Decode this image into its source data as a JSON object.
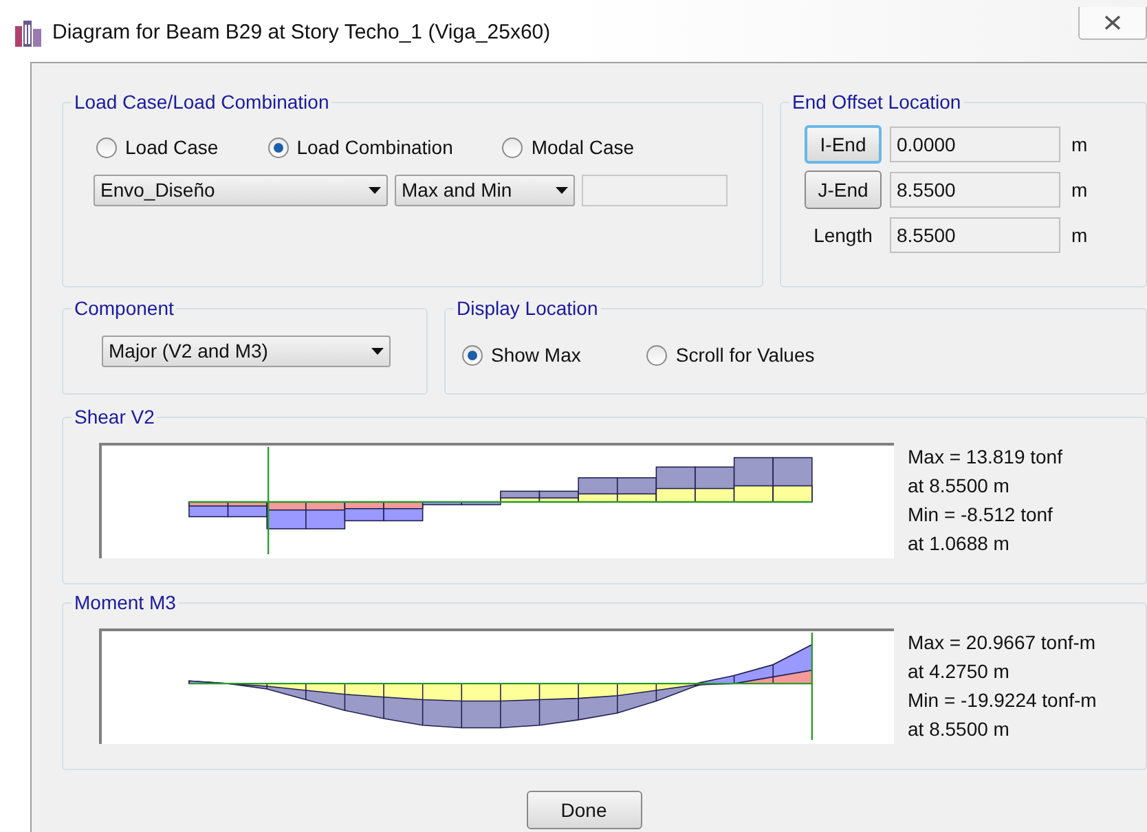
{
  "window": {
    "title": "Diagram for Beam B29 at Story Techo_1 (Viga_25x60)"
  },
  "load_group": {
    "title": "Load Case/Load Combination",
    "options": [
      {
        "label": "Load Case",
        "selected": false
      },
      {
        "label": "Load Combination",
        "selected": true
      },
      {
        "label": "Modal Case",
        "selected": false
      }
    ],
    "combo_dropdown": "Envo_Diseño",
    "type_dropdown": "Max and Min"
  },
  "end_offset": {
    "title": "End Offset Location",
    "rows": [
      {
        "kind": "button",
        "label": "I-End",
        "value": "0.0000",
        "unit": "m",
        "focused": true
      },
      {
        "kind": "button",
        "label": "J-End",
        "value": "8.5500",
        "unit": "m",
        "focused": false
      },
      {
        "kind": "label",
        "label": "Length",
        "value": "8.5500",
        "unit": "m"
      }
    ]
  },
  "component": {
    "title": "Component",
    "dropdown": "Major (V2 and M3)"
  },
  "display_location": {
    "title": "Display Location",
    "options": [
      {
        "label": "Show Max",
        "selected": true
      },
      {
        "label": "Scroll for Values",
        "selected": false
      }
    ]
  },
  "diagrams": [
    {
      "kind": "shear",
      "title": "Shear V2",
      "readouts": [
        "Max = 13.819 tonf",
        "at 8.5500 m",
        "Min = -8.512 tonf",
        "at 1.0688 m"
      ]
    },
    {
      "kind": "moment",
      "title": "Moment M3",
      "readouts": [
        "Max = 20.9667 tonf-m",
        "at 4.2750 m",
        "Min = -19.9224 tonf-m",
        "at 8.5500 m"
      ]
    }
  ],
  "done_button": "Done"
}
